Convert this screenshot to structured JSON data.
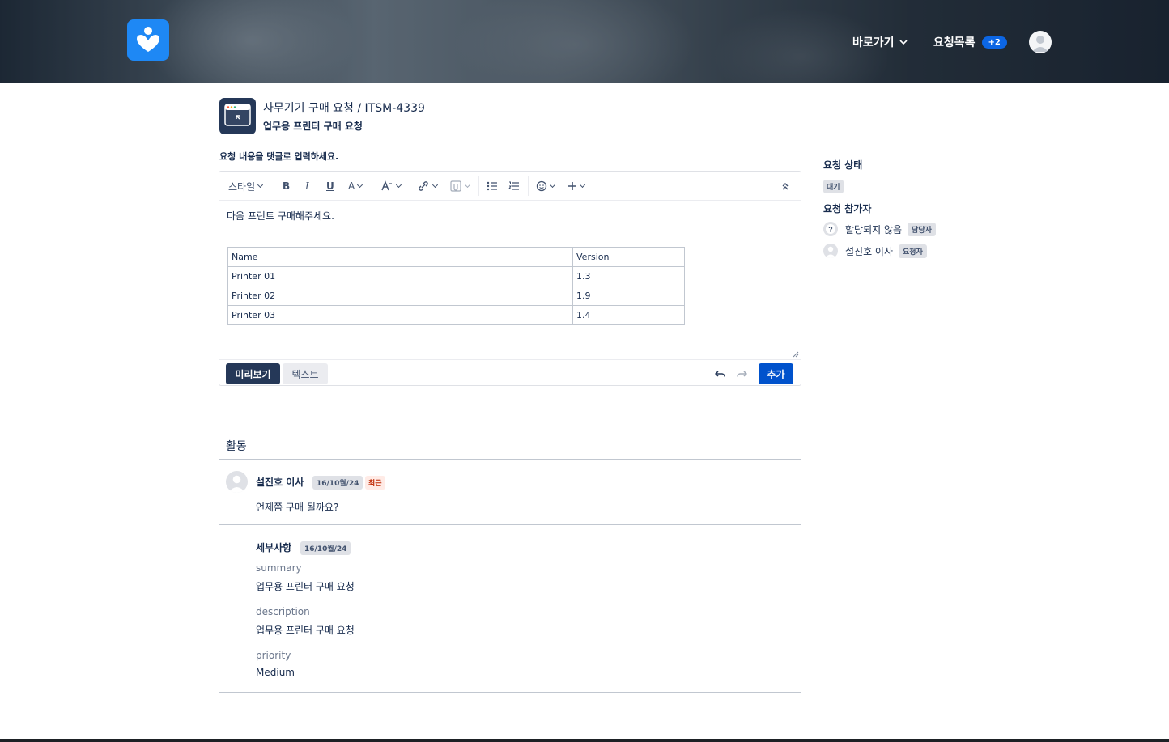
{
  "header": {
    "shortcut_label": "바로가기",
    "requests_label": "요청목록",
    "requests_badge": "+2"
  },
  "request": {
    "breadcrumb": "사무기기 구매 요청 / ITSM-4339",
    "summary": "업무용 프린터 구매 요청",
    "prompt": "요청 내용을 댓글로 입력하세요."
  },
  "editor": {
    "toolbar": {
      "style_label": "스타일",
      "bold": "B",
      "italic": "I",
      "underline": "U",
      "text_color": "A"
    },
    "body_text": "다음 프린트 구매해주세요.",
    "table": {
      "headers": [
        "Name",
        "Version"
      ],
      "rows": [
        [
          "Printer 01",
          "1.3"
        ],
        [
          "Printer 02",
          "1.9"
        ],
        [
          "Printer 03",
          "1.4"
        ]
      ]
    },
    "preview_label": "미리보기",
    "text_label": "텍스트",
    "add_label": "추가"
  },
  "sidebar": {
    "status_heading": "요청 상태",
    "status_value": "대기",
    "participants_heading": "요청 참가자",
    "participants": [
      {
        "name": "할당되지 않음",
        "role": "담당자"
      },
      {
        "name": "설진호 이사",
        "role": "요청자"
      }
    ]
  },
  "activity": {
    "title": "활동",
    "comment": {
      "author": "설진호 이사",
      "date": "16/10월/24",
      "recent_label": "최근",
      "text": "언제쯤 구매 될까요?"
    },
    "details": {
      "title": "세부사항",
      "date": "16/10월/24",
      "fields": [
        {
          "key": "summary",
          "value": "업무용 프린터 구매 요청"
        },
        {
          "key": "description",
          "value": "업무용 프린터 구매 요청"
        },
        {
          "key": "priority",
          "value": "Medium"
        }
      ]
    }
  },
  "colors": {
    "primary": "#0052cc",
    "navy": "#253858",
    "logo": "#1e88f5",
    "badge": "#0c66e4",
    "recent": "#bf2600"
  }
}
